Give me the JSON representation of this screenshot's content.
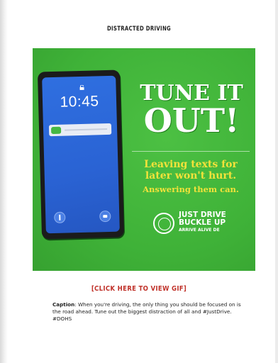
{
  "page": {
    "heading": "DISTRACTED DRIVING",
    "link_text": "[CLICK HERE TO VIEW GIF]",
    "caption_label": "Caption",
    "caption_text": ": When you're driving, the only thing you should be focused on is the road ahead. Tune out the biggest distraction of all and #JustDrive. #DOHS"
  },
  "ad": {
    "phone_time": "10:45",
    "headline_line1": "TUNE IT",
    "headline_line2": "OUT!",
    "subline1": "Leaving texts for",
    "subline2": "later won't hurt.",
    "subline3": "Answering them can.",
    "brand_line1": "JUST DRIVE",
    "brand_line2": "BUCKLE UP",
    "brand_line3": "ARRIVE ALIVE DE",
    "colors": {
      "background": "#3fb238",
      "headline": "#ffffff",
      "subline": "#f3e23a",
      "phone_screen": "#2f6fe0",
      "link": "#c0322a"
    },
    "icons": [
      "lock-icon",
      "message-icon",
      "flashlight-icon",
      "camera-icon",
      "seal-icon"
    ]
  }
}
